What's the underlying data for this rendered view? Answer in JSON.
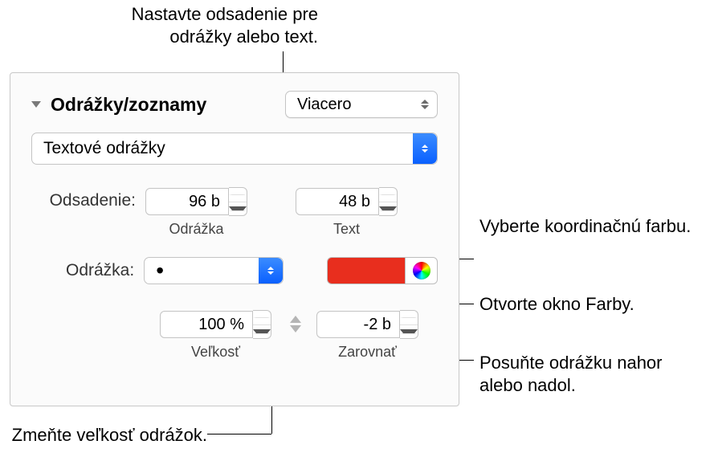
{
  "callouts": {
    "top": "Nastavte odsadenie pre odrážky alebo text.",
    "coord_color": "Vyberte koordinačnú farbu.",
    "open_colors": "Otvorte okno Farby.",
    "align": "Posuňte odrážku nahor alebo nadol.",
    "size": "Zmeňte veľkosť odrážok."
  },
  "section": {
    "title": "Odrážky/zoznamy",
    "style_popup": "Viacero",
    "type_popup": "Textové odrážky"
  },
  "indent": {
    "label": "Odsadenie:",
    "bullet_value": "96 b",
    "bullet_label": "Odrážka",
    "text_value": "48 b",
    "text_label": "Text"
  },
  "bullet": {
    "label": "Odrážka:",
    "char": "•",
    "color": "#E82E1E"
  },
  "size_align": {
    "size_value": "100 %",
    "size_label": "Veľkosť",
    "align_value": "-2 b",
    "align_label": "Zarovnať"
  }
}
